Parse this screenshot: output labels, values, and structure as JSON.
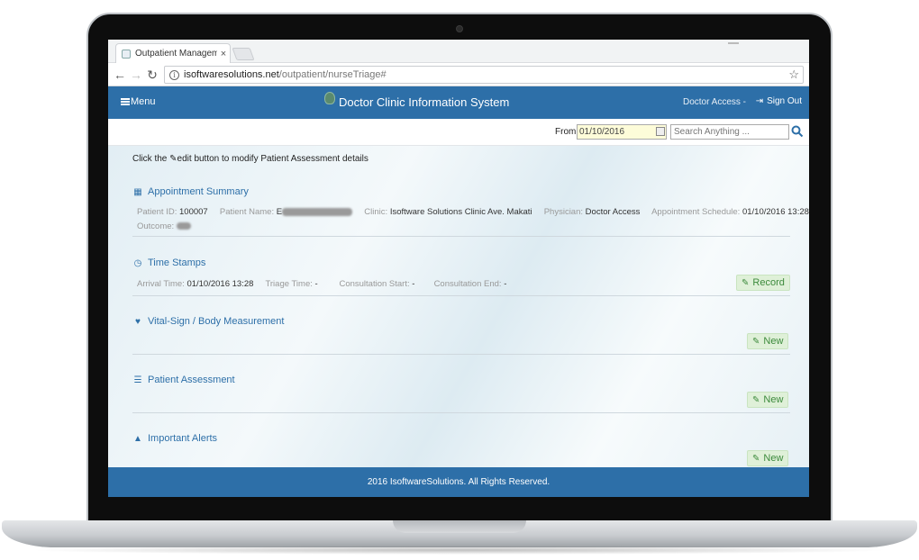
{
  "browser": {
    "tab_title": "Outpatient Management",
    "tab_close": "×",
    "url_host": "isoftwaresolutions.net",
    "url_path": "/outpatient/nurseTriage#"
  },
  "header": {
    "menu_label": "Menu",
    "app_title": "Doctor Clinic Information System",
    "user_label": "Doctor Access  -",
    "signout_label": "Sign Out"
  },
  "filter": {
    "from_label": "From:",
    "from_value": "01/10/2016",
    "search_placeholder": "Search Anything ..."
  },
  "hint": {
    "prefix": "Click the",
    "edit_word": "edit",
    "suffix": "button to modify Patient Assessment details"
  },
  "appointment": {
    "title": "Appointment Summary",
    "patient_id_label": "Patient ID:",
    "patient_id": "100007",
    "patient_name_label": "Patient Name:",
    "patient_name_initial": "E",
    "clinic_label": "Clinic:",
    "clinic": "Isoftware Solutions Clinic Ave. Makati",
    "physician_label": "Physician:",
    "physician": "Doctor Access",
    "schedule_label": "Appointment Schedule:",
    "schedule": "01/10/2016 13:28",
    "outcome_label": "Outcome:"
  },
  "timestamps": {
    "title": "Time Stamps",
    "arrival_label": "Arrival Time:",
    "arrival": "01/10/2016 13:28",
    "triage_label": "Triage Time:",
    "triage": "-",
    "consult_start_label": "Consultation Start:",
    "consult_start": "-",
    "consult_end_label": "Consultation End:",
    "consult_end": "-",
    "record_label": "Record"
  },
  "vitals": {
    "title": "Vital-Sign / Body Measurement",
    "new_label": "New"
  },
  "assessment": {
    "title": "Patient Assessment",
    "new_label": "New"
  },
  "alerts": {
    "title": "Important Alerts",
    "new_label": "New"
  },
  "footer": {
    "text": "2016 IsoftwareSolutions. All Rights Reserved."
  },
  "colors": {
    "primary": "#2d6fa8",
    "success_bg": "#dff0d8",
    "success_text": "#3c8a3c"
  }
}
